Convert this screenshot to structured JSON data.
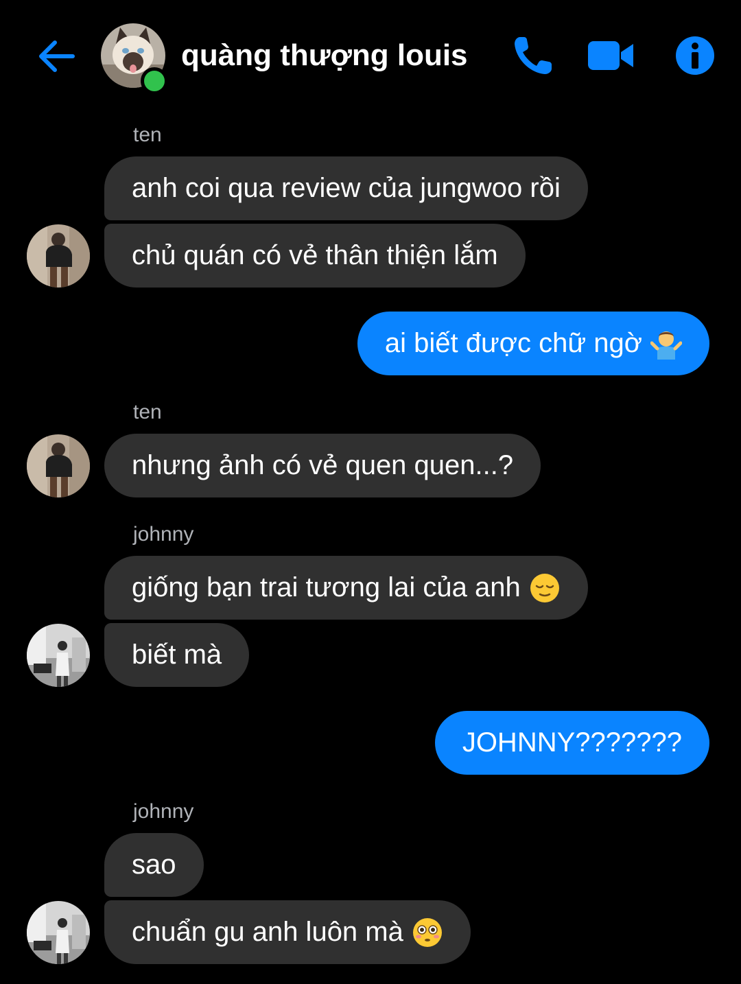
{
  "header": {
    "title": "quàng thượng louis",
    "back_icon": "arrow-left-icon",
    "call_icon": "phone-icon",
    "video_icon": "video-camera-icon",
    "info_icon": "info-icon",
    "accent_color": "#0a84ff",
    "online_color": "#31c24d"
  },
  "messages": [
    {
      "sender": "ten"
    },
    {
      "text": "anh coi qua review của jungwoo rồi"
    },
    {
      "text": "chủ quán có vẻ thân thiện lắm"
    },
    {
      "text": "ai biết được chữ ngờ",
      "emoji": "person-shrugging-emoji"
    },
    {
      "sender": "ten"
    },
    {
      "text": "nhưng ảnh có vẻ quen quen...?"
    },
    {
      "sender": "johnny"
    },
    {
      "text": "giống bạn trai tương lai của anh",
      "emoji": "relieved-face-emoji"
    },
    {
      "text": "biết mà"
    },
    {
      "text": "JOHNNY???????"
    },
    {
      "sender": "johnny"
    },
    {
      "text": "sao"
    },
    {
      "text": "chuẩn gu anh luôn mà",
      "emoji": "flushed-face-emoji"
    }
  ],
  "colors": {
    "incoming_bubble": "#303030",
    "outgoing_bubble": "#0a84ff",
    "sender_label": "#b0b3b8",
    "background": "#000000"
  }
}
